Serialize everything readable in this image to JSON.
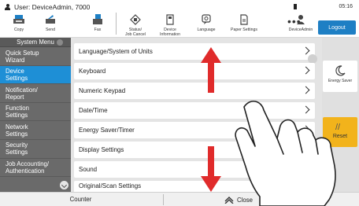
{
  "header": {
    "user_label": "User: DeviceAdmin, 7000",
    "time": "05:16",
    "toolbar": [
      {
        "label": "Copy",
        "icon": "copy-icon"
      },
      {
        "label": "Send",
        "icon": "send-icon"
      },
      {
        "label": "Fax",
        "icon": "fax-icon"
      },
      {
        "label": "Status/\nJob Cancel",
        "icon": "status-icon"
      },
      {
        "label": "Device\nInformation",
        "icon": "device-info-icon"
      },
      {
        "label": "Language",
        "icon": "language-icon"
      },
      {
        "label": "Paper Settings",
        "icon": "paper-settings-icon"
      },
      {
        "label": "DeviceAdmin",
        "icon": "user-icon"
      }
    ],
    "more": "•••",
    "logout_label": "Logout"
  },
  "sidebar": {
    "title": "System Menu",
    "items": [
      {
        "label": "Quick Setup\nWizard"
      },
      {
        "label": "Device\nSettings"
      },
      {
        "label": "Notification/\nReport"
      },
      {
        "label": "Function\nSettings"
      },
      {
        "label": "Network\nSettings"
      },
      {
        "label": "Security\nSettings"
      },
      {
        "label": "Job Accounting/\nAuthentication"
      }
    ],
    "active_index": 1
  },
  "list": {
    "items": [
      "Language/System of Units",
      "Keyboard",
      "Numeric Keypad",
      "Date/Time",
      "Energy Saver/Timer",
      "Display Settings",
      "Sound",
      "Original/Scan Settings"
    ]
  },
  "right_panel": {
    "energy_saver_label": "Energy Saver",
    "reset_label": "Reset"
  },
  "footer": {
    "counter_label": "Counter",
    "close_label": "Close"
  },
  "colors": {
    "accent": "#1e8fd6",
    "logout": "#1e7fc4",
    "reset": "#f2b31b",
    "arrow": "#e02b2b",
    "sidebar": "#6a6a6a"
  }
}
